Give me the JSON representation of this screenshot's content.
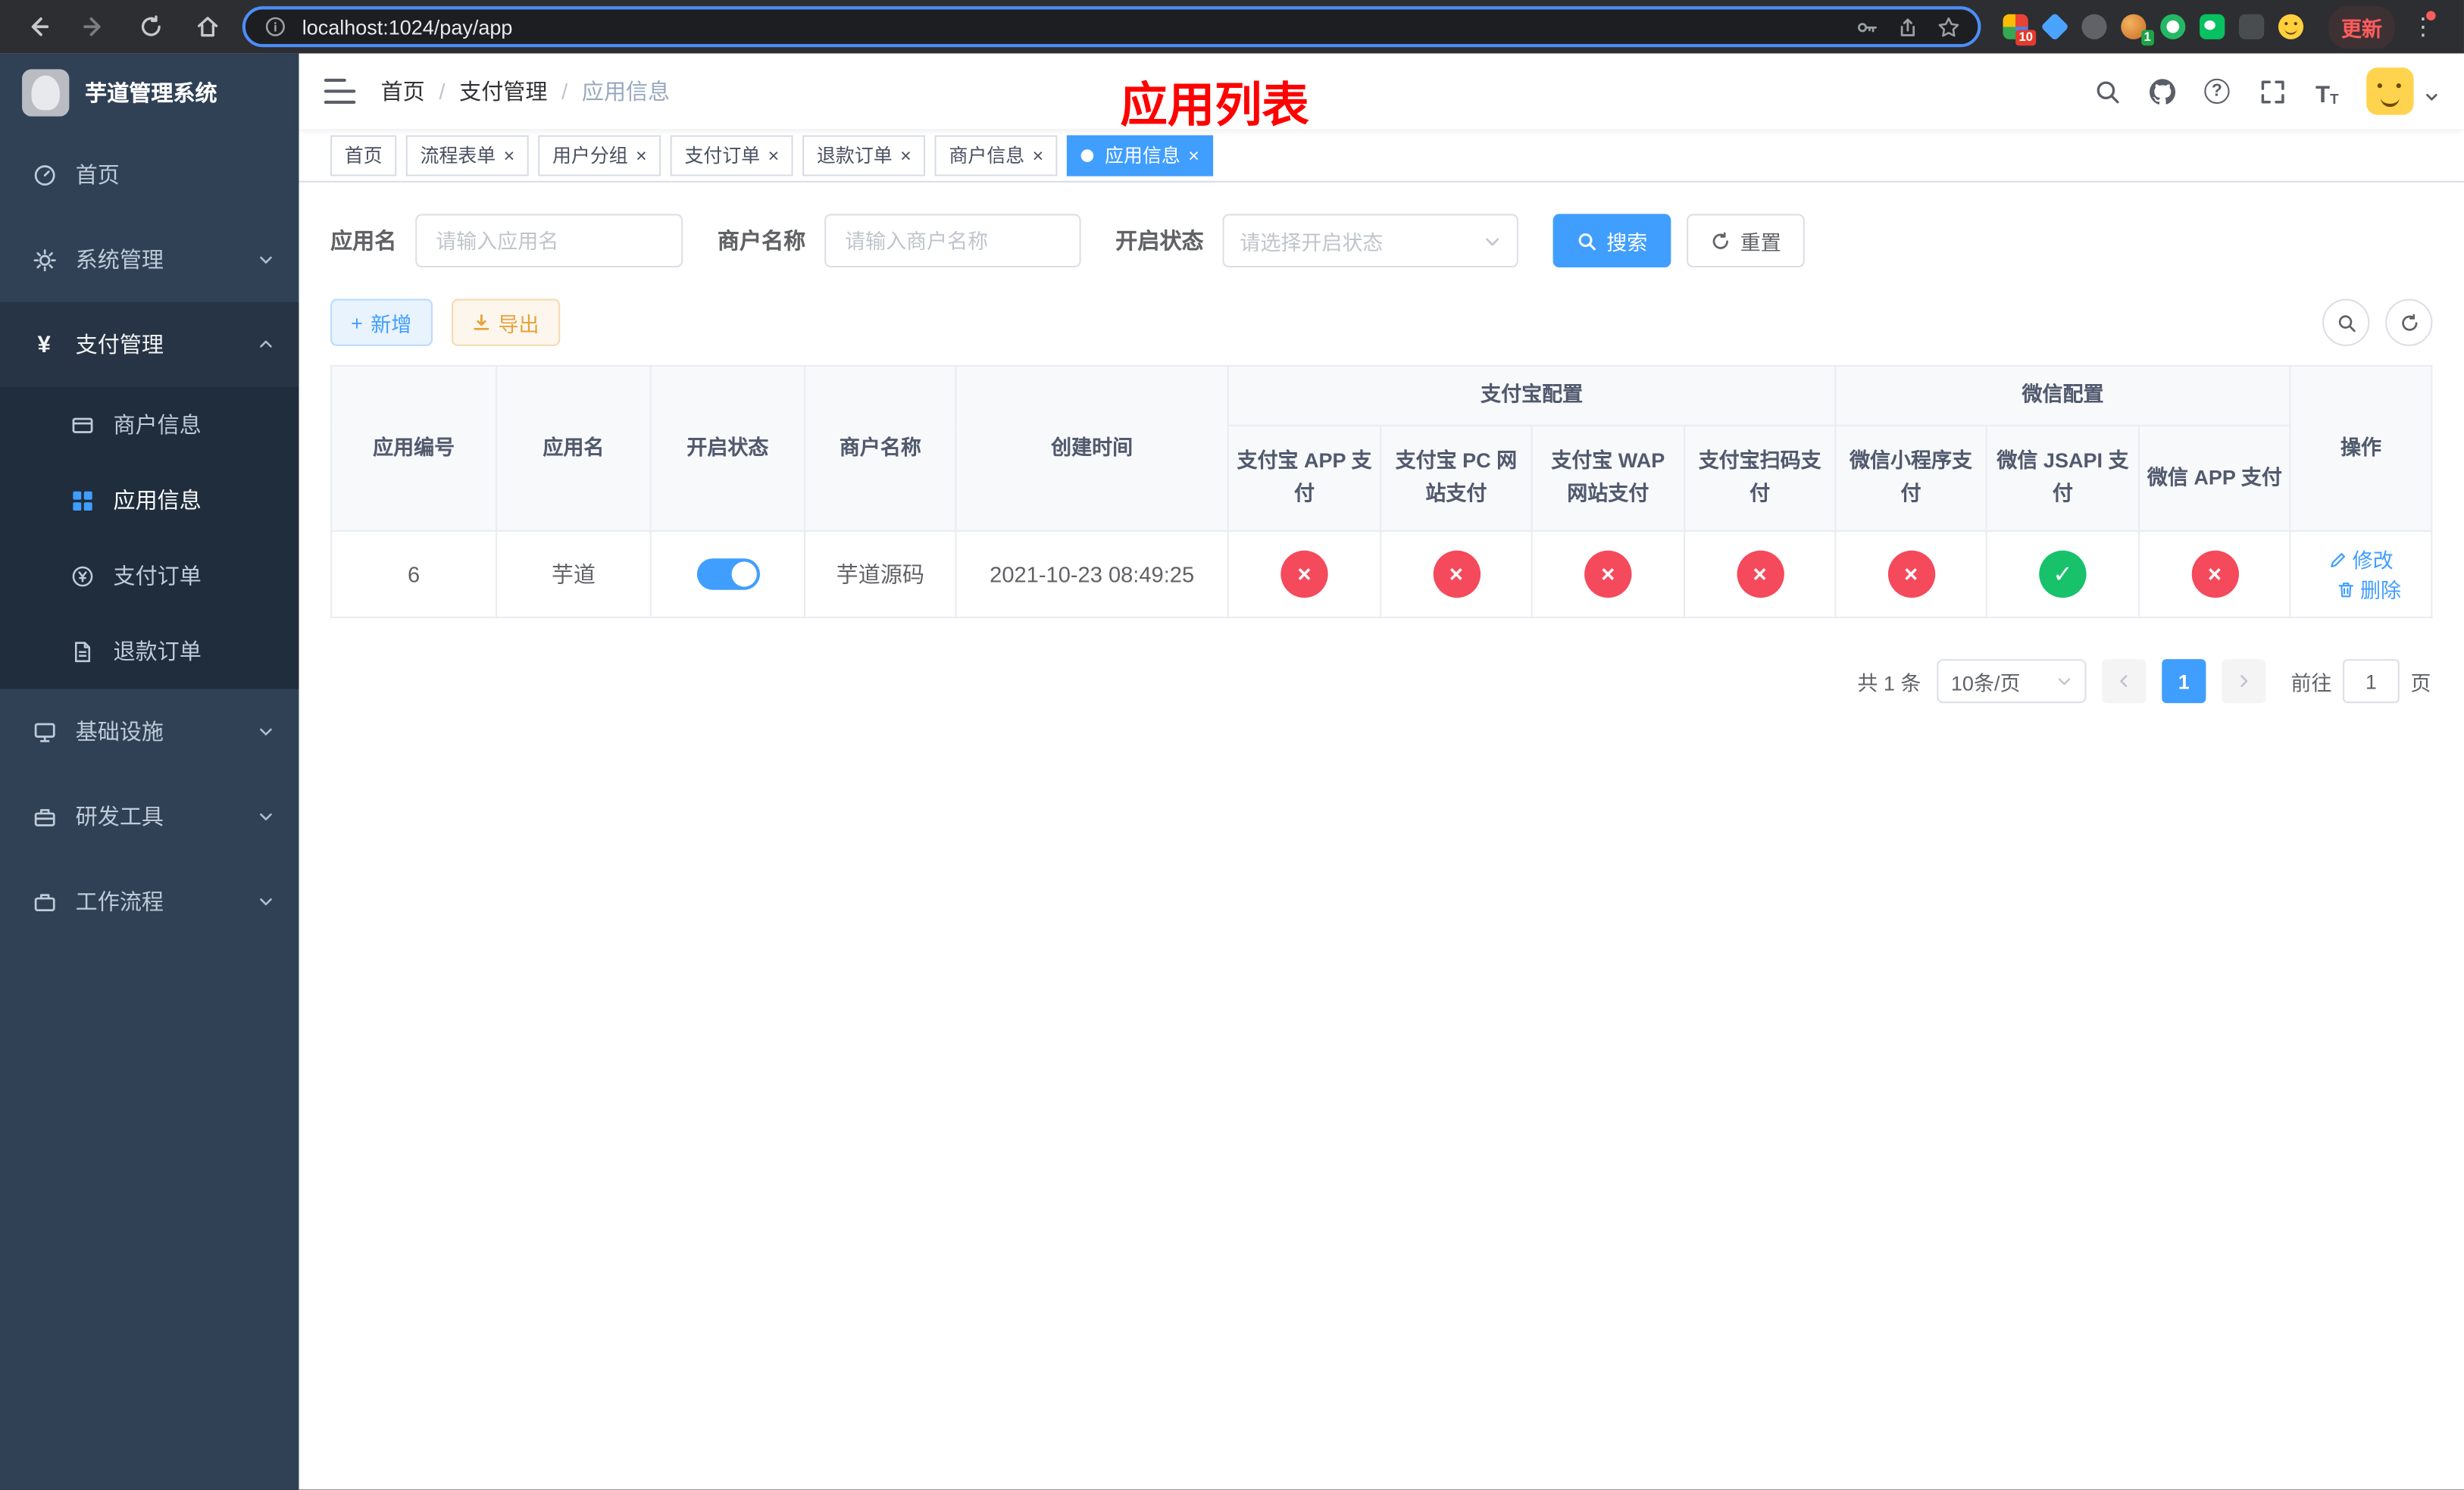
{
  "browser": {
    "url": "localhost:1024/pay/app",
    "update_button": "更新",
    "extension_badges": {
      "grid": "10",
      "avatar": "1"
    }
  },
  "app": {
    "title": "芋道管理系统",
    "annotation": "应用列表"
  },
  "breadcrumb": {
    "items": [
      "首页",
      "支付管理",
      "应用信息"
    ]
  },
  "sidebar": {
    "items": {
      "home": "首页",
      "system": "系统管理",
      "payment": "支付管理",
      "merchant_info": "商户信息",
      "app_info": "应用信息",
      "pay_order": "支付订单",
      "refund_order": "退款订单",
      "infra": "基础设施",
      "dev_tools": "研发工具",
      "workflow": "工作流程"
    }
  },
  "tabs": [
    {
      "label": "首页"
    },
    {
      "label": "流程表单"
    },
    {
      "label": "用户分组"
    },
    {
      "label": "支付订单"
    },
    {
      "label": "退款订单"
    },
    {
      "label": "商户信息"
    },
    {
      "label": "应用信息"
    }
  ],
  "filters": {
    "app_name_label": "应用名",
    "app_name_placeholder": "请输入应用名",
    "merchant_label": "商户名称",
    "merchant_placeholder": "请输入商户名称",
    "status_label": "开启状态",
    "status_placeholder": "请选择开启状态",
    "search_button": "搜索",
    "reset_button": "重置"
  },
  "toolbar": {
    "add_button": "新增",
    "export_button": "导出"
  },
  "table": {
    "headers": {
      "app_id": "应用编号",
      "app_name": "应用名",
      "status": "开启状态",
      "merchant_name": "商户名称",
      "create_time": "创建时间",
      "alipay_group": "支付宝配置",
      "alipay_app": "支付宝 APP 支付",
      "alipay_pc": "支付宝 PC 网站支付",
      "alipay_wap": "支付宝 WAP 网站支付",
      "alipay_qr": "支付宝扫码支付",
      "wechat_group": "微信配置",
      "wechat_mini": "微信小程序支付",
      "wechat_jsapi": "微信 JSAPI 支付",
      "wechat_app": "微信 APP 支付",
      "actions": "操作"
    },
    "row": {
      "app_id": "6",
      "app_name": "芋道",
      "status_enabled": true,
      "merchant_name": "芋道源码",
      "create_time": "2021-10-23 08:49:25",
      "channels": {
        "alipay_app": false,
        "alipay_pc": false,
        "alipay_wap": false,
        "alipay_qr": false,
        "wechat_mini": false,
        "wechat_jsapi": true,
        "wechat_app": false
      },
      "edit": "修改",
      "delete": "删除"
    }
  },
  "pagination": {
    "total": "共 1 条",
    "page_size": "10条/页",
    "current_page": "1",
    "goto_prefix": "前往",
    "goto_value": "1",
    "goto_suffix": "页"
  },
  "colors": {
    "primary": "#409eff",
    "success": "#17c26b",
    "danger": "#f5495c",
    "warning": "#e6a23c",
    "annotation": "#ff0000",
    "sidebar_bg": "#304156",
    "submenu_bg": "#1f2d3d"
  }
}
